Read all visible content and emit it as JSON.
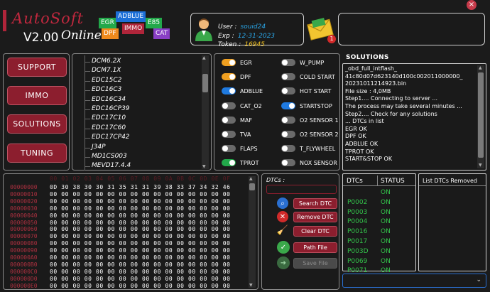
{
  "brand": {
    "name": "AutoSoft",
    "version": "V2.00",
    "edition": "Online"
  },
  "tags": [
    "EGR",
    "ADBLUE",
    "E85",
    "DPF",
    "IMMO",
    "CAT"
  ],
  "tag_colors": {
    "EGR": "#22a84a",
    "ADBLUE": "#1c6fd8",
    "E85": "#22a84a",
    "DPF": "#f08a1c",
    "IMMO": "#b0253a",
    "CAT": "#8a3fc6"
  },
  "user": {
    "user_label": "User :",
    "user_value": "souid24",
    "exp_label": "Exp :",
    "exp_value": "12-31-2023",
    "token_label": "Token :",
    "token_value": "16945",
    "notifications": "1"
  },
  "menu": [
    "SUPPORT",
    "IMMO",
    "SOLUTIONS",
    "TUNING"
  ],
  "ecu_list": [
    "DCM6.2X",
    "DCM7.1X",
    "EDC15C2",
    "EDC16C3",
    "EDC16C34",
    "EDC16CP39",
    "EDC17C10",
    "EDC17C60",
    "EDC17CP42",
    "J34P",
    "MD1CS003",
    "MEVD17.4.4"
  ],
  "toggles_left": [
    {
      "label": "EGR",
      "on": true,
      "color": "#f0a020"
    },
    {
      "label": "DPF",
      "on": true,
      "color": "#f0a020"
    },
    {
      "label": "ADBLUE",
      "on": true,
      "color": "#1f7ae0"
    },
    {
      "label": "CAT_O2",
      "on": false,
      "color": "#777"
    },
    {
      "label": "MAF",
      "on": false,
      "color": "#777"
    },
    {
      "label": "TVA",
      "on": false,
      "color": "#777"
    },
    {
      "label": "FLAPS",
      "on": false,
      "color": "#777"
    },
    {
      "label": "TPROT",
      "on": true,
      "color": "#22a84a"
    }
  ],
  "toggles_right": [
    {
      "label": "W_PUMP",
      "on": false,
      "color": "#777"
    },
    {
      "label": "COLD START",
      "on": false,
      "color": "#777"
    },
    {
      "label": "HOT START",
      "on": false,
      "color": "#777"
    },
    {
      "label": "STARTSTOP",
      "on": true,
      "color": "#1f7ae0"
    },
    {
      "label": "O2 SENSOR 1",
      "on": false,
      "color": "#777"
    },
    {
      "label": "O2 SENSOR 2",
      "on": false,
      "color": "#777"
    },
    {
      "label": "T_FLYWHEEL",
      "on": false,
      "color": "#777"
    },
    {
      "label": "NOX SENSOR",
      "on": false,
      "color": "#777"
    }
  ],
  "solutions": {
    "title": "SOLUTIONS",
    "lines": [
      "_obd_full_intflash_",
      "41c80d07d623140d100c002011000000_",
      "20231011214923.bin",
      "File size : 4,0MB",
      "Step1.... Connecting to server ...",
      "The process may take several minutes ...",
      "Step2.... Check for any solutions",
      "... DTCs in list",
      "EGR OK",
      "DPF OK",
      "ADBLUE OK",
      "TPROT OK",
      "START&STOP OK"
    ]
  },
  "hex": {
    "header": "00 01 02 03 04 05 06 07 08 09 0A 0B 0C 0D 0E 0F",
    "rows": [
      {
        "addr": "00000000",
        "bytes": "0D 30 38 30 30 31 35 31 31 39 38 33 37 34 32 46"
      },
      {
        "addr": "00000010",
        "bytes": "00 00 00 00 00 00 00 00 00 00 00 00 00 00 00 00"
      },
      {
        "addr": "00000020",
        "bytes": "00 00 00 00 00 00 00 00 00 00 00 00 00 00 00 00"
      },
      {
        "addr": "00000030",
        "bytes": "00 00 00 00 00 00 00 00 00 00 00 00 00 00 00 00"
      },
      {
        "addr": "00000040",
        "bytes": "00 00 00 00 00 00 00 00 00 00 00 00 00 00 00 00"
      },
      {
        "addr": "00000050",
        "bytes": "00 00 00 00 00 00 00 00 00 00 00 00 00 00 00 00"
      },
      {
        "addr": "00000060",
        "bytes": "00 00 00 00 00 00 00 00 00 00 00 00 00 00 00 00"
      },
      {
        "addr": "00000070",
        "bytes": "00 00 00 00 00 00 00 00 00 00 00 00 00 00 00 00"
      },
      {
        "addr": "00000080",
        "bytes": "00 00 00 00 00 00 00 00 00 00 00 00 00 00 00 00"
      },
      {
        "addr": "00000090",
        "bytes": "00 00 00 00 00 00 00 00 00 00 00 00 00 00 00 00"
      },
      {
        "addr": "000000A0",
        "bytes": "00 00 00 00 00 00 00 00 00 00 00 00 00 00 00 00"
      },
      {
        "addr": "000000B0",
        "bytes": "00 00 00 00 00 00 00 00 00 00 00 00 00 00 00 00"
      },
      {
        "addr": "000000C0",
        "bytes": "00 00 00 00 00 00 00 00 00 00 00 00 00 00 00 00"
      },
      {
        "addr": "000000D0",
        "bytes": "00 00 00 00 00 00 00 00 00 00 00 00 00 00 00 00"
      },
      {
        "addr": "000000E0",
        "bytes": "00 00 00 00 00 00 00 00 00 00 00 00 00 00 00 00"
      }
    ]
  },
  "dtc_panel": {
    "label": "DTCs :",
    "input_value": "",
    "search": "Search DTC",
    "remove": "Remove DTC",
    "clear": "Clear DTC",
    "path": "Path File",
    "save": "Save File"
  },
  "dtc_table": {
    "col1": "DTCs",
    "col2": "STATUS",
    "removed_header": "List DTCs Removed",
    "rows": [
      {
        "code": "",
        "status": "ON"
      },
      {
        "code": "P0002",
        "status": "ON"
      },
      {
        "code": "P0003",
        "status": "ON"
      },
      {
        "code": "P0004",
        "status": "ON"
      },
      {
        "code": "P0016",
        "status": "ON"
      },
      {
        "code": "P0017",
        "status": "ON"
      },
      {
        "code": "P003D",
        "status": "ON"
      },
      {
        "code": "P0069",
        "status": "ON"
      },
      {
        "code": "P0071",
        "status": "ON"
      }
    ]
  },
  "dropdown": {
    "value": ""
  }
}
